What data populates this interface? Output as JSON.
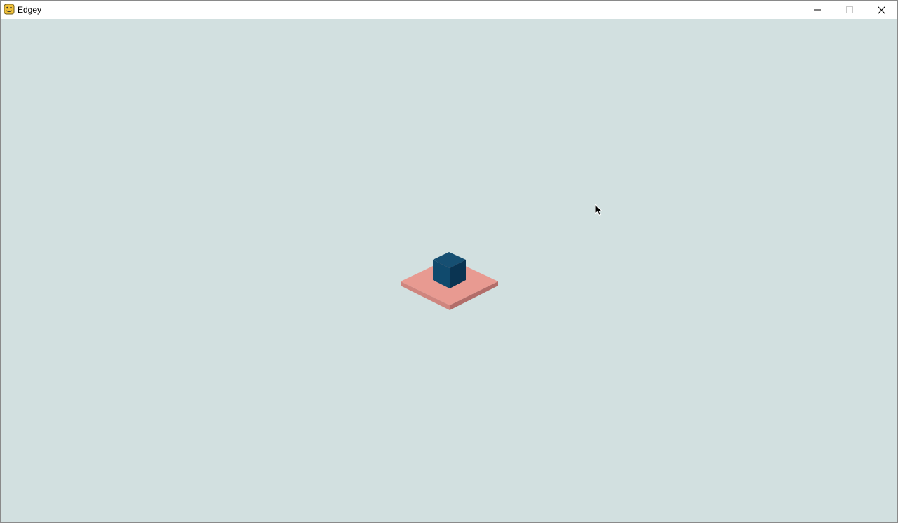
{
  "window": {
    "title": "Edgey",
    "controls": {
      "minimize": "minimize",
      "maximize": "maximize",
      "close": "close"
    }
  },
  "icons": {
    "app": "pygame-snake-icon",
    "minimize": "minimize-icon",
    "maximize": "maximize-icon",
    "close": "close-icon",
    "cursor": "mouse-pointer-icon"
  },
  "colors": {
    "background": "#d2e0e0",
    "platform_top": "#e89a91",
    "platform_side_left": "#cf857e",
    "platform_side_right": "#b26d69",
    "cube_top": "#164f72",
    "cube_left": "#104a6d",
    "cube_right": "#0a3452"
  },
  "scene": {
    "objects": [
      "platform",
      "cube"
    ]
  }
}
